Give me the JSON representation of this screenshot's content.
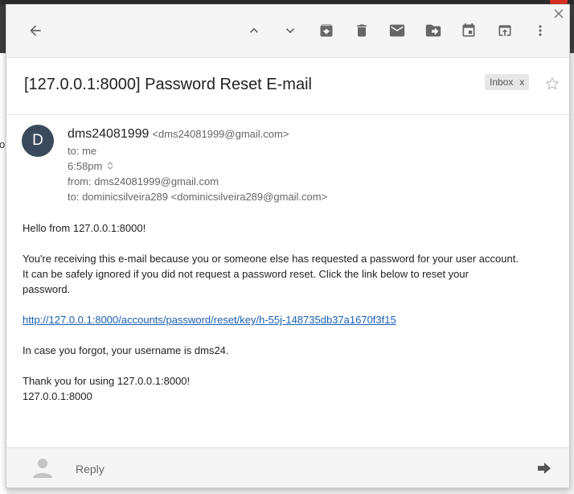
{
  "email": {
    "subject": "[127.0.0.1:8000] Password Reset E-mail",
    "label": "Inbox",
    "label_remove": "x",
    "sender_initial": "D",
    "sender_name": "dms24081999",
    "sender_email": "<dms24081999@gmail.com>",
    "to_short": "to: me",
    "time": "6:58pm",
    "from_full": "from: dms24081999@gmail.com",
    "to_full": "to: dominicsilveira289 <dominicsilveira289@gmail.com>",
    "body": {
      "p1": "Hello from 127.0.0.1:8000!",
      "p2_l1": "You're receiving this e-mail because you or someone else has requested a password for your user account.",
      "p2_l2": "It can be safely ignored if you did not request a password reset. Click the link below to reset your",
      "p2_l3": "password.",
      "link": "http://127.0.0.1:8000/accounts/password/reset/key/h-55j-148735db37a1670f3f15",
      "p3": "In case you forgot, your username is dms24.",
      "p4_l1": "Thank you for using 127.0.0.1:8000!",
      "p4_l2": "127.0.0.1:8000"
    }
  },
  "reply": {
    "placeholder": "Reply"
  },
  "background": {
    "left_char": "o"
  },
  "toolbar_icons": [
    "back-arrow-icon",
    "chevron-up-icon",
    "chevron-down-icon",
    "archive-icon",
    "trash-icon",
    "mark-unread-icon",
    "move-to-icon",
    "snooze-icon",
    "open-in-new-icon",
    "more-vert-icon"
  ],
  "colors": {
    "accent_link": "#1a5fb4",
    "avatar": "#3a4a5c"
  }
}
